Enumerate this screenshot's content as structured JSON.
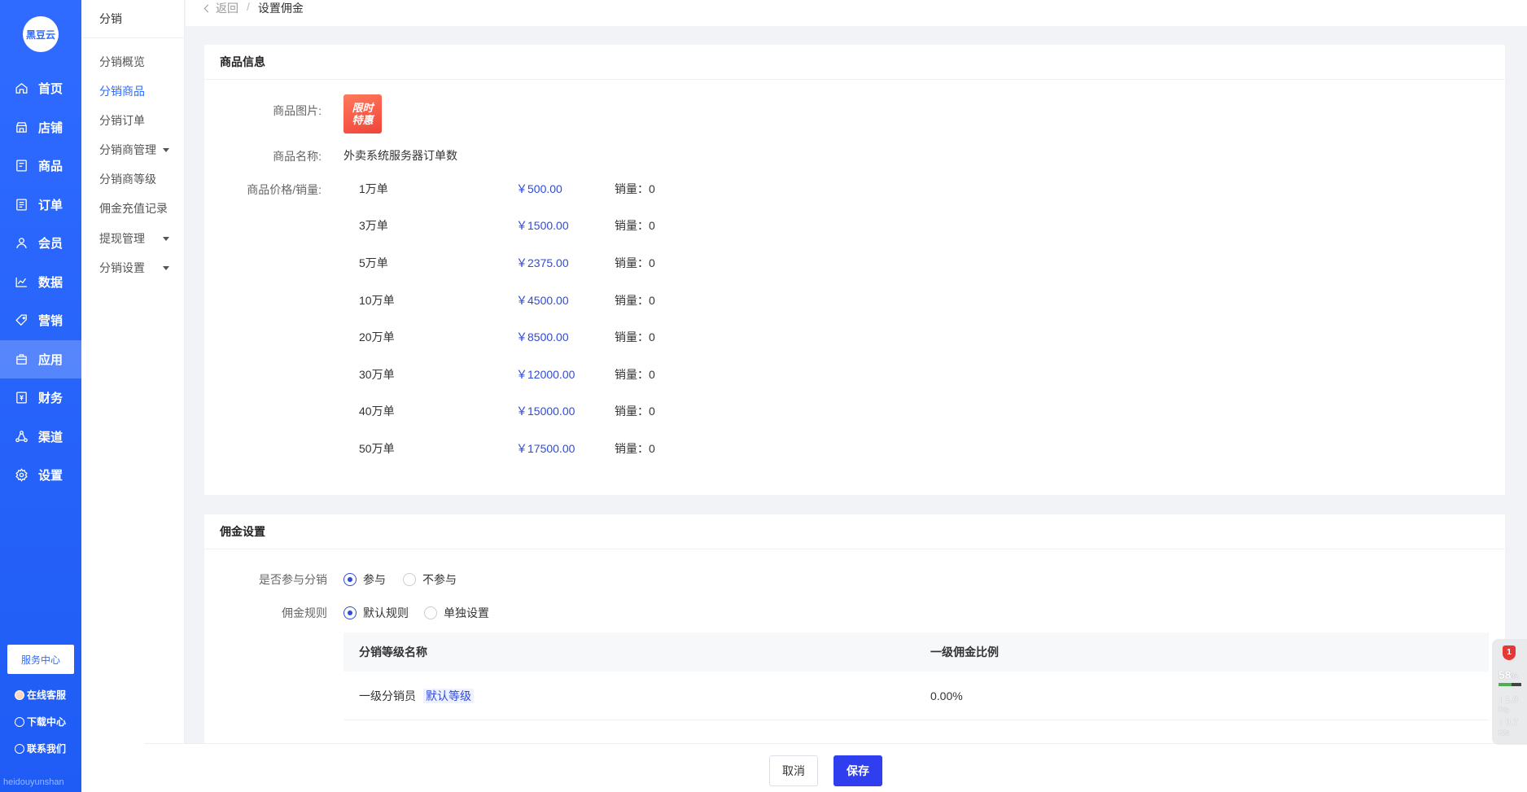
{
  "brand": {
    "logo_text": "黑豆云",
    "watermark": "heidouyunshan"
  },
  "main_nav": [
    {
      "label": "首页",
      "icon": "home-icon"
    },
    {
      "label": "店铺",
      "icon": "store-icon"
    },
    {
      "label": "商品",
      "icon": "goods-icon"
    },
    {
      "label": "订单",
      "icon": "order-icon"
    },
    {
      "label": "会员",
      "icon": "member-icon"
    },
    {
      "label": "数据",
      "icon": "chart-icon"
    },
    {
      "label": "营销",
      "icon": "tag-icon"
    },
    {
      "label": "应用",
      "icon": "app-icon",
      "active": true
    },
    {
      "label": "财务",
      "icon": "finance-icon"
    },
    {
      "label": "渠道",
      "icon": "channel-icon"
    },
    {
      "label": "设置",
      "icon": "gear-icon"
    }
  ],
  "sidebar_bottom": {
    "service_center": "服务中心",
    "online_service": "在线客服",
    "download_center": "下载中心",
    "contact_us": "联系我们"
  },
  "sub_nav": {
    "title": "分销",
    "items": [
      {
        "label": "分销概览"
      },
      {
        "label": "分销商品",
        "active": true
      },
      {
        "label": "分销订单"
      },
      {
        "label": "分销商管理",
        "has_caret": true
      },
      {
        "label": "分销商等级"
      },
      {
        "label": "佣金充值记录"
      },
      {
        "label": "提现管理",
        "has_caret": true
      },
      {
        "label": "分销设置",
        "has_caret": true
      }
    ]
  },
  "breadcrumb": {
    "back": "返回",
    "separator": "/",
    "current": "设置佣金"
  },
  "product_info": {
    "title": "商品信息",
    "image_label": "商品图片:",
    "image_text_1": "限时",
    "image_text_2": "特惠",
    "name_label": "商品名称:",
    "name": "外卖系统服务器订单数",
    "price_label": "商品价格/销量:",
    "sales_prefix": "销量：",
    "specs": [
      {
        "spec": "1万单",
        "price": "￥500.00",
        "sales": "0"
      },
      {
        "spec": "3万单",
        "price": "￥1500.00",
        "sales": "0"
      },
      {
        "spec": "5万单",
        "price": "￥2375.00",
        "sales": "0"
      },
      {
        "spec": "10万单",
        "price": "￥4500.00",
        "sales": "0"
      },
      {
        "spec": "20万单",
        "price": "￥8500.00",
        "sales": "0"
      },
      {
        "spec": "30万单",
        "price": "￥12000.00",
        "sales": "0"
      },
      {
        "spec": "40万单",
        "price": "￥15000.00",
        "sales": "0"
      },
      {
        "spec": "50万单",
        "price": "￥17500.00",
        "sales": "0"
      }
    ]
  },
  "commission": {
    "title": "佣金设置",
    "participate_label": "是否参与分销",
    "participate_yes": "参与",
    "participate_no": "不参与",
    "rule_label": "佣金规则",
    "rule_default": "默认规则",
    "rule_custom": "单独设置",
    "table": {
      "headers": [
        "分销等级名称",
        "一级佣金比例"
      ],
      "rows": [
        {
          "name": "一级分销员",
          "tag": "默认等级",
          "ratio": "0.00%"
        }
      ]
    }
  },
  "footer": {
    "cancel": "取消",
    "save": "保存"
  },
  "widget": {
    "badge": "1",
    "percent": "58",
    "percent_unit": "%",
    "upload": "1.0",
    "download": "0.7",
    "unit": "K/s"
  }
}
